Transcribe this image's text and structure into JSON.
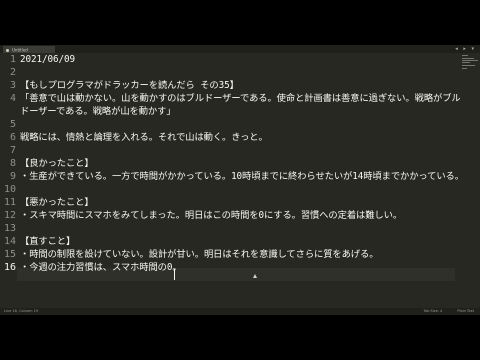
{
  "window": {
    "tab_title": "Untitled",
    "nav_left": "◂",
    "nav_right": "▸",
    "nav_menu": "▾"
  },
  "editor": {
    "lines": [
      {
        "number": "1",
        "text": "2021/06/09"
      },
      {
        "number": "2",
        "text": ""
      },
      {
        "number": "3",
        "text": "【もしプログラマがドラッカーを読んだら その35】"
      },
      {
        "number": "4",
        "text": "「善意で山は動かない。山を動かすのはブルドーザーである。使命と計画書は善意に過ぎない。戦略がブル"
      },
      {
        "number": "",
        "text": "ドーザーである。戦略が山を動かす」"
      },
      {
        "number": "5",
        "text": ""
      },
      {
        "number": "6",
        "text": "戦略には、情熱と論理を入れる。それで山は動く。きっと。"
      },
      {
        "number": "7",
        "text": ""
      },
      {
        "number": "8",
        "text": "【良かったこと】"
      },
      {
        "number": "9",
        "text": "・生産ができている。一方で時間がかかっている。10時頃までに終わらせたいが14時頃までかかっている。"
      },
      {
        "number": "10",
        "text": ""
      },
      {
        "number": "11",
        "text": "【悪かったこと】"
      },
      {
        "number": "12",
        "text": "・スキマ時間にスマホをみてしまった。明日はこの時間を0にする。習慣への定着は難しい。"
      },
      {
        "number": "13",
        "text": ""
      },
      {
        "number": "14",
        "text": "【直すこと】"
      },
      {
        "number": "15",
        "text": "・時間の制限を設けていない。設計が甘い。明日はそれを意識してさらに質をあげる。"
      },
      {
        "number": "16",
        "text": "・今週の注力習慣は、スマホ時間の0。"
      }
    ],
    "active_line": "16"
  },
  "status": {
    "left": "Line 16, Column 19",
    "right_1": "Tab Size: 4",
    "right_2": "Plain Text"
  },
  "colors": {
    "background": "#272822",
    "text": "#f8f8f2",
    "gutter_text": "#8f908a"
  }
}
